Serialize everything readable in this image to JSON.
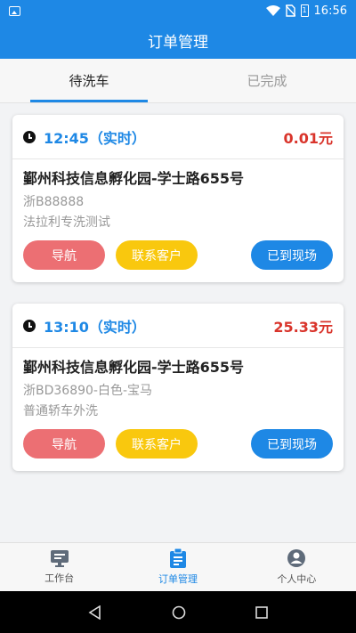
{
  "status_bar": {
    "time": "16:56",
    "battery_level": "1",
    "icons": [
      "image-icon",
      "wifi-icon",
      "sim-icon",
      "battery-icon"
    ]
  },
  "app_bar": {
    "title": "订单管理"
  },
  "tabs": [
    {
      "label": "待洗车",
      "active": true
    },
    {
      "label": "已完成",
      "active": false
    }
  ],
  "orders": [
    {
      "time": "12:45（实时）",
      "price": "0.01元",
      "address": "鄞州科技信息孵化园-学士路655号",
      "vehicle": "浙B88888",
      "service": "法拉利专洗测试",
      "buttons": {
        "navigate": "导航",
        "contact": "联系客户",
        "arrived": "已到现场"
      }
    },
    {
      "time": "13:10（实时）",
      "price": "25.33元",
      "address": "鄞州科技信息孵化园-学士路655号",
      "vehicle": "浙BD36890-白色-宝马",
      "service": "普通轿车外洗",
      "buttons": {
        "navigate": "导航",
        "contact": "联系客户",
        "arrived": "已到现场"
      }
    }
  ],
  "bottom_nav": [
    {
      "label": "工作台",
      "icon": "monitor-icon",
      "active": false
    },
    {
      "label": "订单管理",
      "icon": "clipboard-icon",
      "active": true
    },
    {
      "label": "个人中心",
      "icon": "person-icon",
      "active": false
    }
  ],
  "colors": {
    "primary": "#1e88e5",
    "price": "#d9342b",
    "navigate_button": "#ec6f73",
    "contact_button": "#f9c80e"
  }
}
